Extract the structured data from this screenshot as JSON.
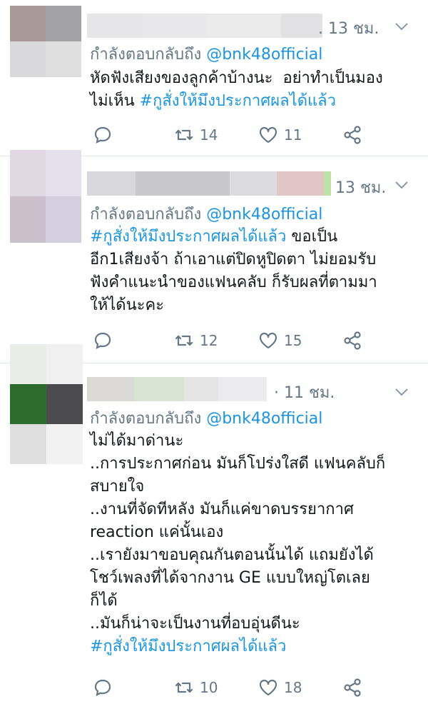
{
  "colors": {
    "link": "#1b95e0",
    "muted": "#657786",
    "text": "#14171a"
  },
  "tweets": [
    {
      "time": ". 13 ชม.",
      "replying_prefix": "กำลังตอบกลับถึง",
      "handle": "@bnk48official",
      "body_line1": "หัดฟังเสียงของลูกค้าบ้างนะ  อย่าทำเป็นมอง",
      "body_line2_text": "ไม่เห็น ",
      "hashtag": "#กูสั่งให้มึงประกาศผลได้แล้ว",
      "retweets": "14",
      "likes": "11"
    },
    {
      "time": "13 ชม.",
      "replying_prefix": "กำลังตอบกลับถึง",
      "handle": "@bnk48official",
      "hashtag": "#กูสั่งให้มึงประกาศผลได้แล้ว",
      "body_line1_rest": " ขอเป็น",
      "body_lines": "อีก1เสียงจ้า ถ้าเอาแต่ปิดหูปิดตา ไม่ยอมรับ\nฟังคำแนะนำของแฟนคลับ ก็รับผลที่ตามมา\nให้ได้นะคะ",
      "retweets": "12",
      "likes": "15"
    },
    {
      "time": "· 11 ชม.",
      "replying_prefix": "กำลังตอบกลับถึง",
      "handle": "@bnk48official",
      "body_lines": "ไม่ได้มาด่านะ\n..การประกาศก่อน มันก็โปร่งใสดี แฟนคลับก็\nสบายใจ\n..งานที่จัดทีหลัง มันก็แค่ขาดบรรยากาศ\nreaction แค่นั้นเอง\n..เรายังมาขอบคุณกันตอนนั้นได้ แถมยังได้\nโชว์เพลงที่ได้จากงาน GE แบบใหญ่โตเลย\nก็ได้\n..มันก็น่าจะเป็นงานที่อบอุ่นดีนะ",
      "hashtag": "#กูสั่งให้มึงประกาศผลได้แล้ว",
      "retweets": "10",
      "likes": "18"
    }
  ],
  "icons": [
    "reply-icon",
    "retweet-icon",
    "like-icon",
    "share-icon",
    "chevron-down-icon"
  ]
}
